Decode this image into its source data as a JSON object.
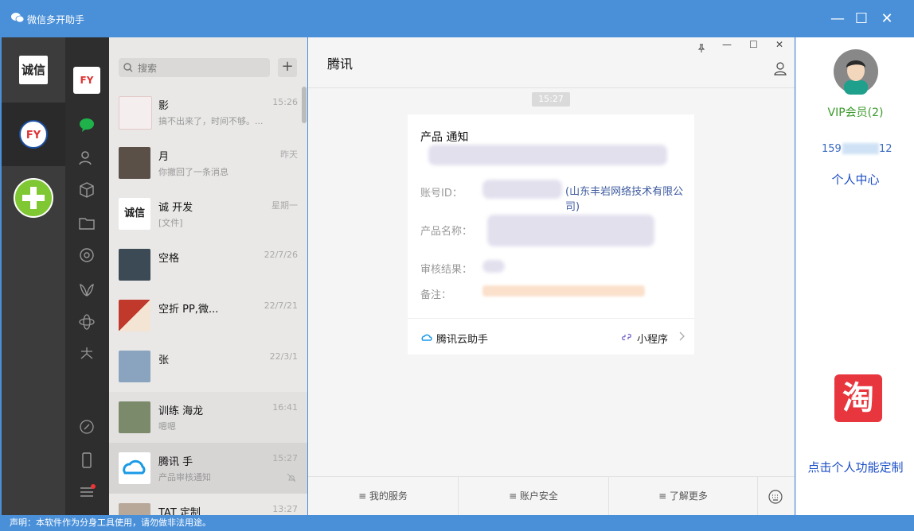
{
  "app": {
    "title": "微信多开助手"
  },
  "window_controls": {
    "minimize": "—",
    "maximize": "☐",
    "close": "✕"
  },
  "rail": {
    "account1_logo": "诚信",
    "account2_logo": "FY"
  },
  "search": {
    "placeholder": "搜索",
    "add": "+"
  },
  "chats": [
    {
      "name": "影",
      "time": "15:26",
      "preview": "搞不出来了，时间不够。..."
    },
    {
      "name": "月",
      "time": "昨天",
      "preview": "你撤回了一条消息"
    },
    {
      "name": "诚 开发",
      "time": "星期一",
      "preview": "[文件]"
    },
    {
      "name": "空格",
      "time": "22/7/26",
      "preview": ""
    },
    {
      "name": "空折 PP,微...",
      "time": "22/7/21",
      "preview": ""
    },
    {
      "name": "张",
      "time": "22/3/1",
      "preview": ""
    },
    {
      "name": "训练 海龙",
      "time": "16:41",
      "preview": "嗯嗯"
    },
    {
      "name": "腾讯 手",
      "time": "15:27",
      "preview": "产品审核通知"
    },
    {
      "name": "TAT 定制",
      "time": "13:27",
      "preview": ""
    }
  ],
  "chat": {
    "title": "腾讯",
    "time": "15:27",
    "card": {
      "title": "产品 通知",
      "account_label": "账号ID：",
      "account_company": "(山东丰岩网络技术有限公司)",
      "product_label": "产品名称：",
      "review_label": "审核结果：",
      "note_label": "备注：",
      "source": "腾讯云助手",
      "mini_program": "小程序"
    },
    "bottom": [
      "≡ 我的服务",
      "≡ 账户安全",
      "≡ 了解更多"
    ]
  },
  "right": {
    "vip": "VIP会员(2)",
    "phone_prefix": "159",
    "phone_suffix": "12",
    "personal_center": "个人中心",
    "taobao": "淘",
    "customize": "点击个人功能定制"
  },
  "status": "声明：本软件作为分身工具使用，请勿做非法用途。"
}
